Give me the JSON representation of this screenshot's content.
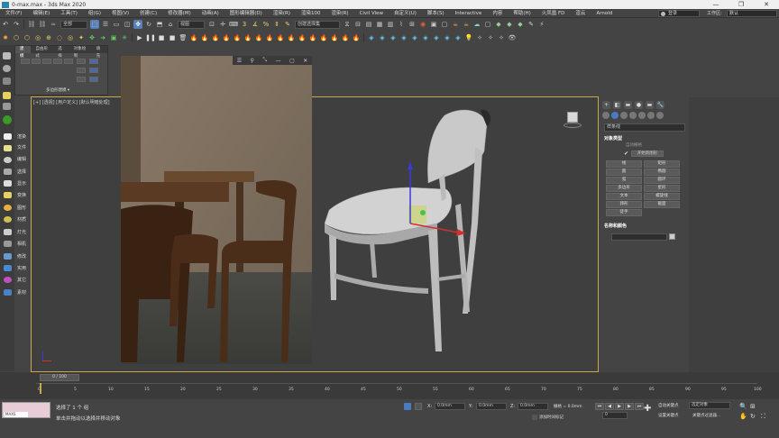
{
  "window": {
    "title": "0-max.max - 3ds Max 2020",
    "minimize": "—",
    "maximize": "❐",
    "close": "✕"
  },
  "menu": {
    "items": [
      "文件(F)",
      "编辑(E)",
      "工具(T)",
      "组(G)",
      "视图(V)",
      "创建(C)",
      "修改器(M)",
      "动画(A)",
      "图形编辑器(D)",
      "渲染(R)",
      "渲染100",
      "渲染(R)",
      "Civil View",
      "自定义(U)",
      "脚本(S)",
      "Interactive",
      "内容",
      "帮助(H)",
      "火凤凰 FD",
      "渲云",
      "Arnold"
    ],
    "login": "登录",
    "workspace_label": "工作区:",
    "workspace_value": "默认"
  },
  "toolbar1": {
    "selection_filter": "全部",
    "coord_system": "视图",
    "named_selection": "创建选择集"
  },
  "ribbon": {
    "tabs": [
      "建模",
      "自由形式",
      "选择",
      "对象绘制",
      "填充"
    ],
    "poly_label": "多边形建模 ▾"
  },
  "left_strip": {
    "labels": [
      "渲染",
      "文件",
      "编辑",
      "选择",
      "显示",
      "变换",
      "图形",
      "材质",
      "灯光",
      "相机",
      "修改",
      "实用",
      "其它",
      "素材"
    ]
  },
  "viewport": {
    "label": "[+] [透视] [用户定义] [默认明暗处理]"
  },
  "command_panel": {
    "tabs": [
      "+",
      "◧",
      "▬",
      "●",
      "▬",
      "🔧"
    ],
    "dropdown": "样条线",
    "object_type_title": "对象类型",
    "autogrid": "自动栅格",
    "start_new_shape": "开始新图形",
    "buttons": [
      "线",
      "矩形",
      "圆",
      "椭圆",
      "弧",
      "圆环",
      "多边形",
      "星形",
      "文本",
      "螺旋线",
      "卵形",
      "截面",
      "徒手"
    ],
    "name_color_title": "名称和颜色"
  },
  "timeline": {
    "frame_display": "0 / 100",
    "ticks": [
      "0",
      "5",
      "10",
      "15",
      "20",
      "25",
      "30",
      "35",
      "40",
      "45",
      "50",
      "55",
      "60",
      "65",
      "70",
      "75",
      "80",
      "85",
      "90",
      "95",
      "100"
    ]
  },
  "status": {
    "script_mini": "MAXS",
    "selection_info": "选择了 1 个 组",
    "prompt": "单击并拖动以选择并移动对象",
    "x_label": "X:",
    "x_value": "0.0mm",
    "y_label": "Y:",
    "y_value": "0.0mm",
    "z_label": "Z:",
    "z_value": "0.0mm",
    "grid": "栅格 = 0.0mm",
    "add_time_tag": "添加时间标记",
    "auto_key": "自动关键点",
    "selected_obj": "选定对象",
    "set_key": "设置关键点",
    "key_filters": "关键点过滤器...",
    "frame": "0"
  },
  "colors": {
    "viewport_border": "#c8a84a",
    "accent_green": "#3a9a2a",
    "script_box": "#e8cdd9"
  }
}
